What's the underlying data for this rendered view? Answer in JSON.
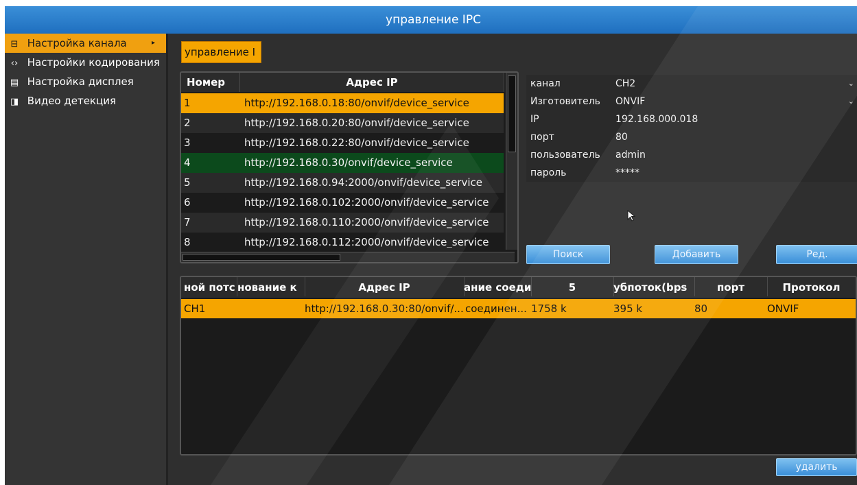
{
  "window": {
    "title": "управление IPC"
  },
  "sidebar": {
    "items": [
      {
        "icon": "channel-setup-icon",
        "glyph": "⊟",
        "label": "Настройка канала",
        "arrow": "▸"
      },
      {
        "icon": "encoding-icon",
        "glyph": "‹›",
        "label": "Настройки кодирования"
      },
      {
        "icon": "display-icon",
        "glyph": "▤",
        "label": "Настройка дисплея"
      },
      {
        "icon": "video-detect-icon",
        "glyph": "◨",
        "label": "Видео детекция"
      }
    ]
  },
  "main_tab": {
    "label": "управление I"
  },
  "search_table": {
    "headers": [
      "Номер",
      "Адрес IP"
    ],
    "rows": [
      {
        "num": "1",
        "addr": "http://192.168.0.18:80/onvif/device_service"
      },
      {
        "num": "2",
        "addr": "http://192.168.0.20:80/onvif/device_service"
      },
      {
        "num": "3",
        "addr": "http://192.168.0.22:80/onvif/device_service"
      },
      {
        "num": "4",
        "addr": "http://192.168.0.30/onvif/device_service"
      },
      {
        "num": "5",
        "addr": "http://192.168.0.94:2000/onvif/device_service"
      },
      {
        "num": "6",
        "addr": "http://192.168.0.102:2000/onvif/device_service"
      },
      {
        "num": "7",
        "addr": "http://192.168.0.110:2000/onvif/device_service"
      },
      {
        "num": "8",
        "addr": "http://192.168.0.112:2000/onvif/device_service"
      }
    ]
  },
  "properties": {
    "channel": {
      "label": "канал",
      "value": "CH2"
    },
    "manufacturer": {
      "label": "Изготовитель",
      "value": "ONVIF"
    },
    "ip": {
      "label": "IP",
      "value": "192.168.000.018"
    },
    "port": {
      "label": "порт",
      "value": "80"
    },
    "user": {
      "label": "пользователь",
      "value": "admin"
    },
    "password": {
      "label": "пароль",
      "value": "*****"
    }
  },
  "buttons": {
    "search": "Поиск",
    "add": "Добавить",
    "edit": "Ред.",
    "delete": "удалить"
  },
  "added_table": {
    "headers": [
      "ной потс",
      "нование к",
      "Адрес IP",
      "ание соеди",
      "5",
      "убпоток(bps",
      "порт",
      "Протокол"
    ],
    "rows": [
      {
        "channel": "CH1",
        "name": "",
        "addr": "http://192.168.0.30:80/onvif/...",
        "status": "соединен...",
        "main": "1758 k",
        "sub": "395 k",
        "port": "80",
        "protocol": "ONVIF"
      }
    ]
  },
  "colors": {
    "accent": "#f5a500",
    "title_blue": "#2a7fd0",
    "selected_green": "#0c4a1c"
  }
}
